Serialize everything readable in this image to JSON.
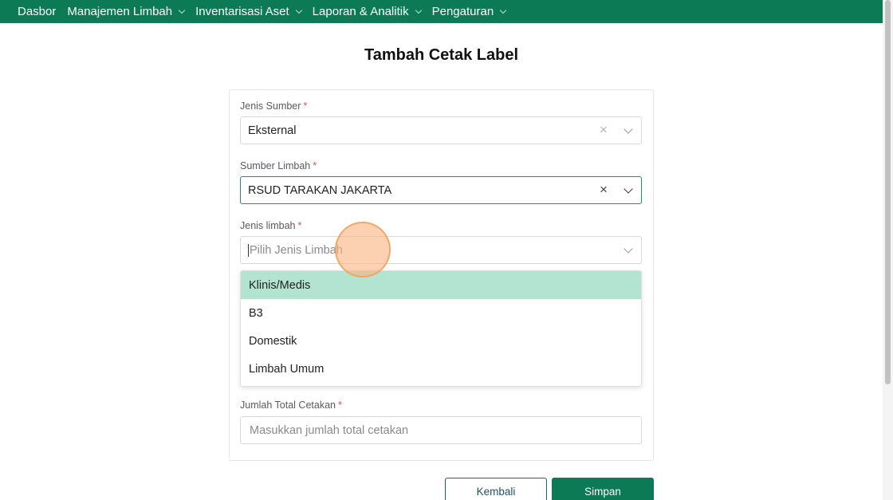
{
  "nav": {
    "items": [
      {
        "label": "Dasbor",
        "has_dropdown": false
      },
      {
        "label": "Manajemen Limbah",
        "has_dropdown": true
      },
      {
        "label": "Inventarisasi Aset",
        "has_dropdown": true
      },
      {
        "label": "Laporan & Analitik",
        "has_dropdown": true
      },
      {
        "label": "Pengaturan",
        "has_dropdown": true
      }
    ]
  },
  "page": {
    "title": "Tambah Cetak Label"
  },
  "form": {
    "required_mark": "*",
    "jenis_sumber": {
      "label": "Jenis Sumber",
      "value": "Eksternal"
    },
    "sumber_limbah": {
      "label": "Sumber Limbah",
      "value": "RSUD TARAKAN JAKARTA"
    },
    "jenis_limbah": {
      "label": "Jenis limbah",
      "placeholder": "Pilih Jenis Limbah",
      "options": [
        "Klinis/Medis",
        "B3",
        "Domestik",
        "Limbah Umum"
      ],
      "highlighted_option": "Klinis/Medis"
    },
    "jumlah_total": {
      "label": "Jumlah Total Cetakan",
      "placeholder": "Masukkan jumlah total cetakan",
      "value": ""
    }
  },
  "buttons": {
    "back": "Kembali",
    "save": "Simpan"
  },
  "colors": {
    "primary": "#0b7a55",
    "option_highlight": "#b3e3d1",
    "required": "#e0524a",
    "click_indicator": "#fab482"
  }
}
